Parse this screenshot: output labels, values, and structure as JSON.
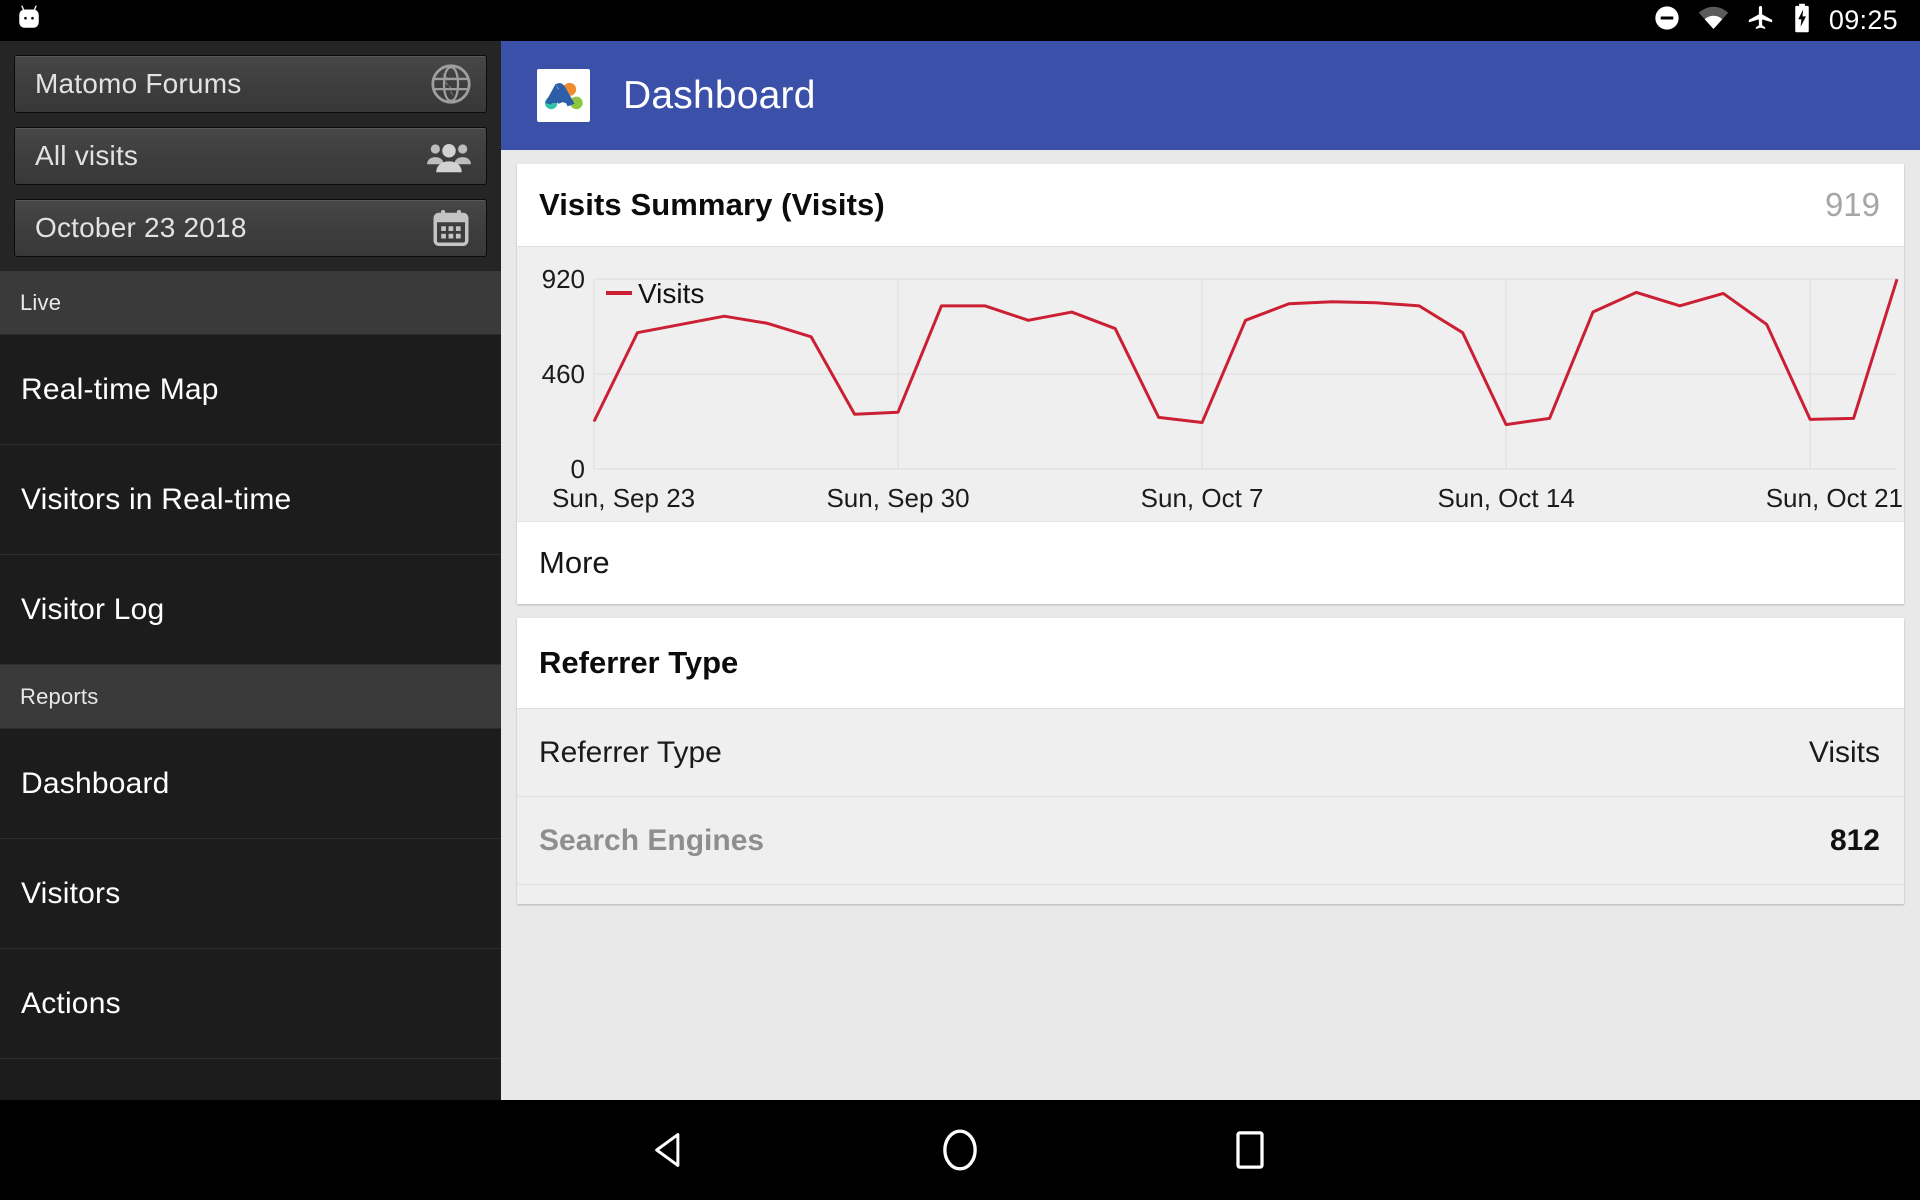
{
  "status_bar": {
    "notification_icon": "android-bugdroid-icon",
    "icons": [
      "do-not-disturb-icon",
      "wifi-icon",
      "airplane-mode-icon",
      "battery-charging-icon"
    ],
    "clock": "09:25"
  },
  "sidebar": {
    "selectors": [
      {
        "label": "Matomo Forums",
        "icon": "globe-icon"
      },
      {
        "label": "All visits",
        "icon": "people-group-icon"
      },
      {
        "label": "October 23 2018",
        "icon": "calendar-icon"
      }
    ],
    "groups": [
      {
        "header": "Live",
        "items": [
          {
            "label": "Real-time Map"
          },
          {
            "label": "Visitors in Real-time"
          },
          {
            "label": "Visitor Log"
          }
        ]
      },
      {
        "header": "Reports",
        "items": [
          {
            "label": "Dashboard"
          },
          {
            "label": "Visitors"
          },
          {
            "label": "Actions"
          }
        ]
      }
    ]
  },
  "appbar": {
    "title": "Dashboard",
    "logo": "matomo-logo-icon",
    "color": "#3b50a8"
  },
  "visits_card": {
    "title": "Visits Summary (Visits)",
    "total": "919",
    "more_label": "More"
  },
  "referrer_card": {
    "title": "Referrer Type",
    "columns": {
      "name": "Referrer Type",
      "value": "Visits"
    },
    "rows": [
      {
        "name": "Search Engines",
        "value": "812"
      }
    ]
  },
  "nav_bar": {
    "back": "back-triangle-icon",
    "home": "home-circle-icon",
    "recents": "recents-square-icon"
  },
  "chart_data": {
    "type": "line",
    "title": "Visits Summary (Visits)",
    "series": [
      {
        "name": "Visits",
        "color": "#cb2033",
        "values": [
          230,
          660,
          700,
          740,
          705,
          640,
          265,
          275,
          790,
          790,
          720,
          760,
          680,
          250,
          225,
          720,
          800,
          810,
          805,
          790,
          660,
          215,
          245,
          760,
          855,
          790,
          850,
          700,
          240,
          245,
          919
        ]
      }
    ],
    "x": [
      "Sun, Sep 23",
      "Mon, Sep 24",
      "Tue, Sep 25",
      "Wed, Sep 26",
      "Thu, Sep 27",
      "Fri, Sep 28",
      "Sat, Sep 29",
      "Sun, Sep 30",
      "Mon, Oct 1",
      "Tue, Oct 2",
      "Wed, Oct 3",
      "Thu, Oct 4",
      "Fri, Oct 5",
      "Sat, Oct 6",
      "Sun, Oct 7",
      "Mon, Oct 8",
      "Tue, Oct 9",
      "Wed, Oct 10",
      "Thu, Oct 11",
      "Fri, Oct 12",
      "Sat, Oct 13",
      "Sun, Oct 14",
      "Mon, Oct 15",
      "Tue, Oct 16",
      "Wed, Oct 17",
      "Thu, Oct 18",
      "Fri, Oct 19",
      "Sat, Oct 20",
      "Sun, Oct 21",
      "Mon, Oct 22",
      "Tue, Oct 23"
    ],
    "xtick_labels": [
      "Sun, Sep 23",
      "Sun, Sep 30",
      "Sun, Oct 7",
      "Sun, Oct 14",
      "Sun, Oct 21"
    ],
    "xtick_indices": [
      0,
      7,
      14,
      21,
      28
    ],
    "ytick_labels": [
      "0",
      "460",
      "920"
    ],
    "ytick_values": [
      0,
      460,
      920
    ],
    "ylim": [
      0,
      920
    ],
    "legend": [
      "Visits"
    ],
    "legend_position": "top-left-inside",
    "grid": true,
    "xlabel": "",
    "ylabel": ""
  }
}
